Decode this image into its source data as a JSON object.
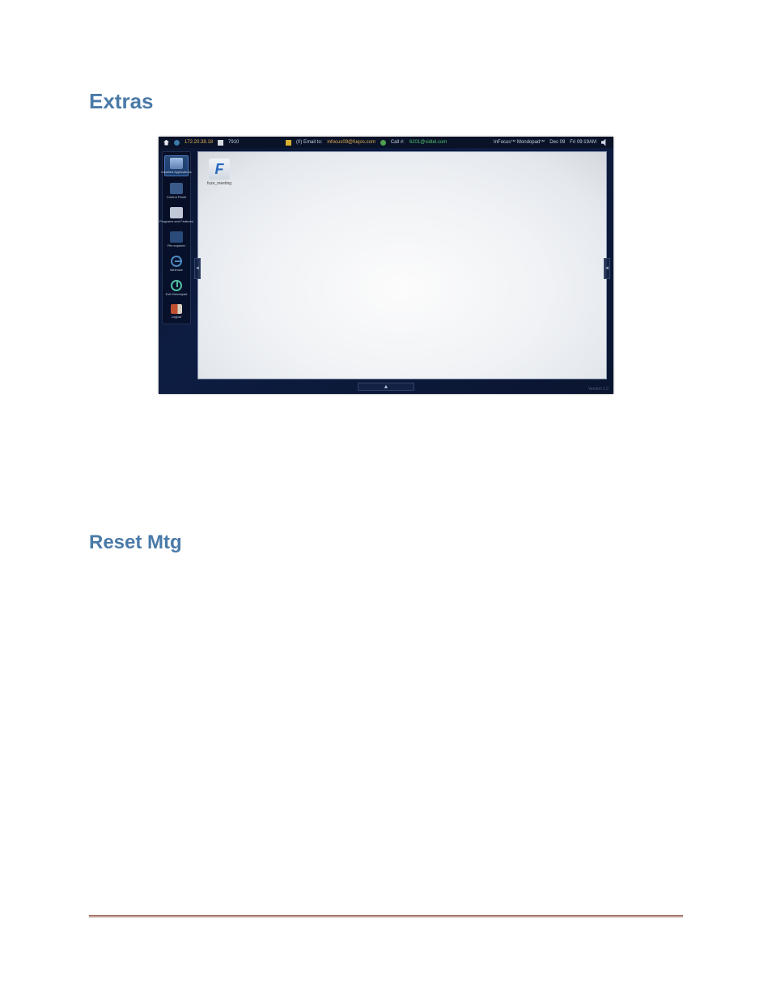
{
  "headings": {
    "extras": "Extras",
    "reset_mtg": "Reset Mtg"
  },
  "topbar": {
    "ip": "172.20.38.18",
    "port": "7910",
    "email_prefix": "(0) Email to:",
    "email_addr": "infocus09@fuqos.com",
    "call_prefix": "Call #:",
    "call_addr": "6201@vidtel.com",
    "product": "InFocus™ Mondopad™",
    "date": "Dec 09",
    "time": "Fri 09:19AM"
  },
  "sidebar": [
    {
      "label": "Installed Applications",
      "icon": "apps",
      "active": true
    },
    {
      "label": "Control Panel",
      "icon": "panel",
      "active": false
    },
    {
      "label": "Programs and Features",
      "icon": "programs",
      "active": false
    },
    {
      "label": "File explorer",
      "icon": "explorer",
      "active": false
    },
    {
      "label": "Minimize",
      "icon": "minimize",
      "active": false
    },
    {
      "label": "Exit Mondopad",
      "icon": "power",
      "active": false
    },
    {
      "label": "Logout",
      "icon": "logout",
      "active": false
    }
  ],
  "canvas": {
    "app_icon_letter": "F",
    "app_icon_label": "fuze_meeting"
  },
  "version": "Version 1.0"
}
